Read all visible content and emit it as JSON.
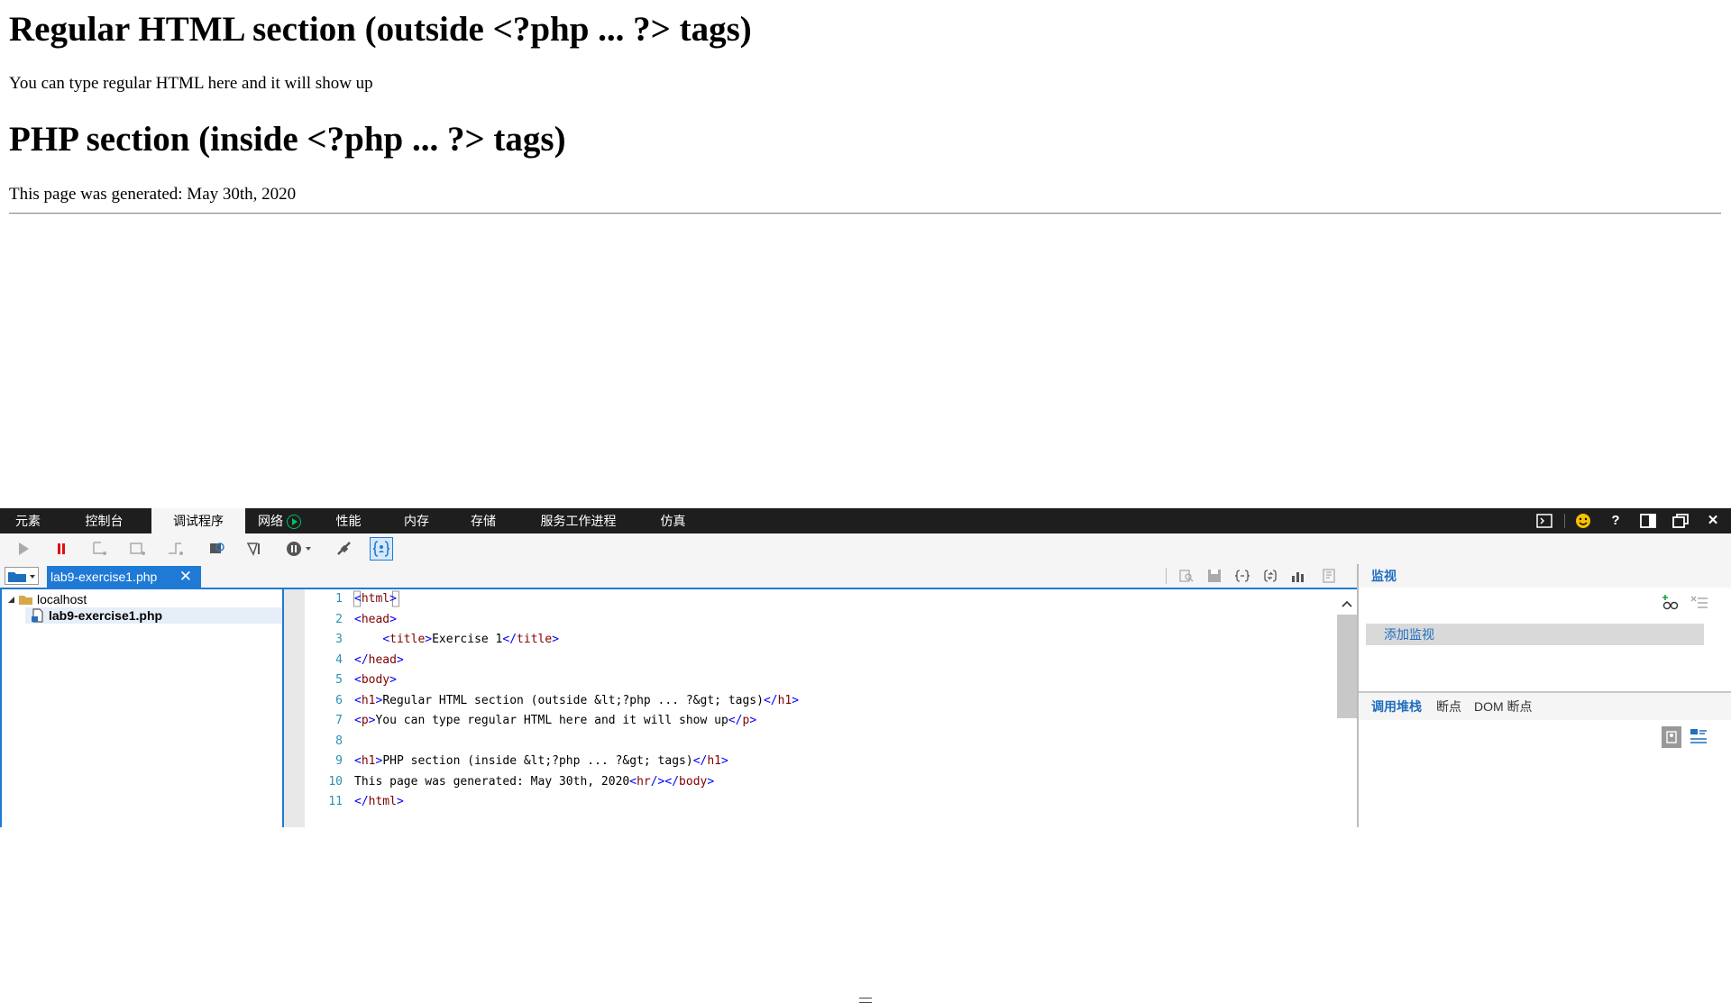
{
  "page": {
    "heading1": "Regular HTML section (outside <?php ... ?> tags)",
    "para1": "You can type regular HTML here and it will show up",
    "heading2": "PHP section (inside <?php ... ?> tags)",
    "para2": "This page was generated: May 30th, 2020"
  },
  "devtools": {
    "tabs": [
      {
        "label": "元素",
        "active": false
      },
      {
        "label": "控制台",
        "active": false
      },
      {
        "label": "调试程序",
        "active": true
      },
      {
        "label": "网络",
        "active": false
      },
      {
        "label": "性能",
        "active": false
      },
      {
        "label": "内存",
        "active": false
      },
      {
        "label": "存储",
        "active": false
      },
      {
        "label": "服务工作进程",
        "active": false
      },
      {
        "label": "仿真",
        "active": false
      }
    ],
    "right_icons": [
      "console-icon",
      "smiley-icon",
      "help-icon",
      "dock-icon",
      "undock-icon",
      "close-icon"
    ],
    "help_glyph": "?",
    "close_glyph": "✕",
    "toolbar_icons": [
      "continue-icon",
      "break-icon",
      "step-into-icon",
      "step-over-icon",
      "step-out-icon",
      "break-on-new-worker-icon",
      "exception-icon",
      "pause-on-exception-icon",
      "disconnect-icon",
      "just-my-code-icon"
    ],
    "file_tab": {
      "label": "lab9-exercise1.php",
      "close": "✕"
    },
    "tree": {
      "root": "localhost",
      "file": "lab9-exercise1.php"
    },
    "code": {
      "line_numbers": [
        "1",
        "2",
        "3",
        "4",
        "5",
        "6",
        "7",
        "8",
        "9",
        "10",
        "11"
      ],
      "lines": [
        "<html>",
        "<head>",
        "    <title>Exercise 1</title>",
        "</head>",
        "<body>",
        "<h1>Regular HTML section (outside &lt;?php ... ?&gt; tags)</h1>",
        "<p>You can type regular HTML here and it will show up</p>",
        "",
        "<h1>PHP section (inside &lt;?php ... ?&gt; tags)</h1>",
        "This page was generated: May 30th, 2020<hr/></body>",
        "</html>"
      ]
    },
    "watch": {
      "title": "监视",
      "add_label": "添加监视"
    },
    "stack_tabs": [
      {
        "label": "调用堆栈",
        "active": true
      },
      {
        "label": "断点",
        "active": false
      },
      {
        "label": "DOM 断点",
        "active": false
      }
    ],
    "colors": {
      "accent": "#1f7ad6",
      "tabbar_bg": "#1e1e1e",
      "tag": "#800000",
      "bracket": "#0000ff",
      "line_number": "#2b91af"
    }
  }
}
